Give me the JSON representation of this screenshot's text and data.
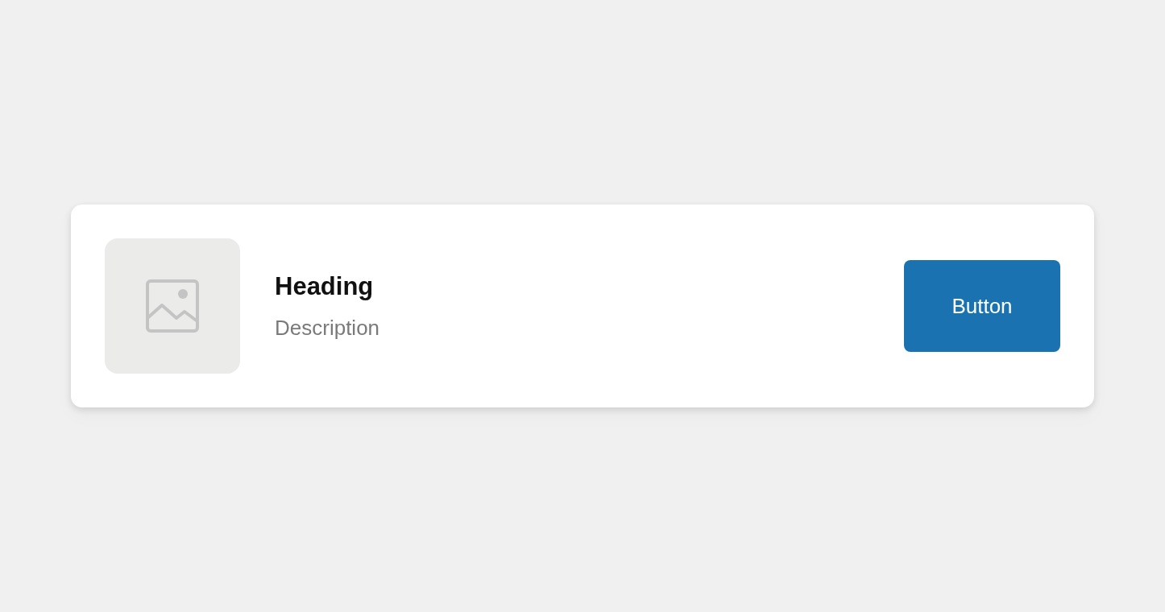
{
  "card": {
    "heading": "Heading",
    "description": "Description",
    "button": {
      "label": "Button"
    }
  }
}
